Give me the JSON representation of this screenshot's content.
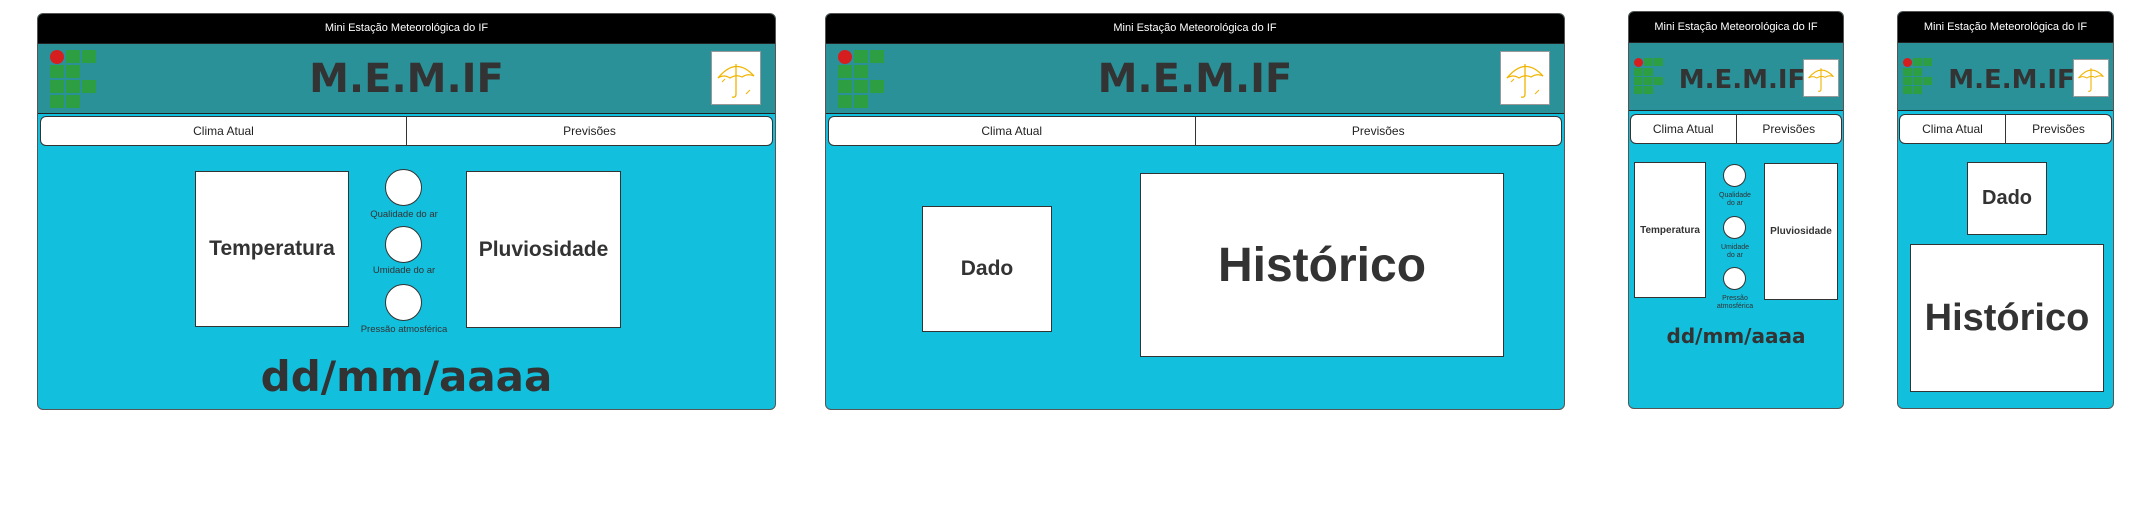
{
  "window_title": "Mini Estação Meteorológica do IF",
  "app_title": "M.E.M.IF",
  "tabs": {
    "current": "Clima Atual",
    "forecast": "Previsões"
  },
  "current": {
    "temperature": "Temperatura",
    "rainfall": "Pluviosidade",
    "air_quality": "Qualidade do ar",
    "air_humidity": "Umidade do ar",
    "air_pressure": "Pressão atmosférica",
    "date": "dd/mm/aaaa"
  },
  "forecast": {
    "data": "Dado",
    "history": "Histórico"
  },
  "mobile_labels": {
    "air_quality": "Qualidade do ar",
    "air_humidity": "Umidade do ar",
    "air_pressure": "Pressão atmosférica"
  },
  "colors": {
    "background": "#12bfdd",
    "header": "#2b9199",
    "titlebar": "#000000",
    "logo_green": "#2e9e42",
    "logo_red": "#d61e1e",
    "umbrella": "#f0b400"
  },
  "icons": {
    "logo": "if-logo-icon",
    "umbrella": "umbrella-icon"
  }
}
